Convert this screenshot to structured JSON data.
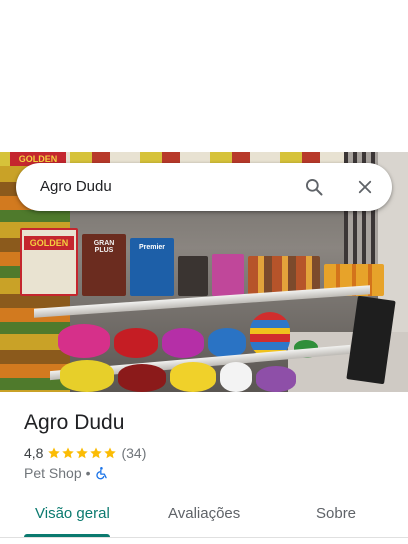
{
  "search": {
    "query": "Agro Dudu"
  },
  "hero": {
    "photo_signs": {
      "top_sign": "GOLDEN",
      "product_golden": "GOLDEN",
      "product_granplus": "GRAN PLUS",
      "product_premier": "Premier"
    }
  },
  "place": {
    "name": "Agro Dudu",
    "rating": "4,8",
    "review_count": "(34)",
    "stars": 5,
    "category": "Pet Shop",
    "separator": "•"
  },
  "tabs": [
    {
      "label": "Visão geral",
      "active": true
    },
    {
      "label": "Avaliações",
      "active": false
    },
    {
      "label": "Sobre",
      "active": false
    }
  ],
  "colors": {
    "accent": "#0b7a6f",
    "star": "#fbbc04",
    "accessibility": "#1a73e8"
  },
  "icons": [
    "search-icon",
    "close-icon",
    "star-icon",
    "wheelchair-icon"
  ]
}
